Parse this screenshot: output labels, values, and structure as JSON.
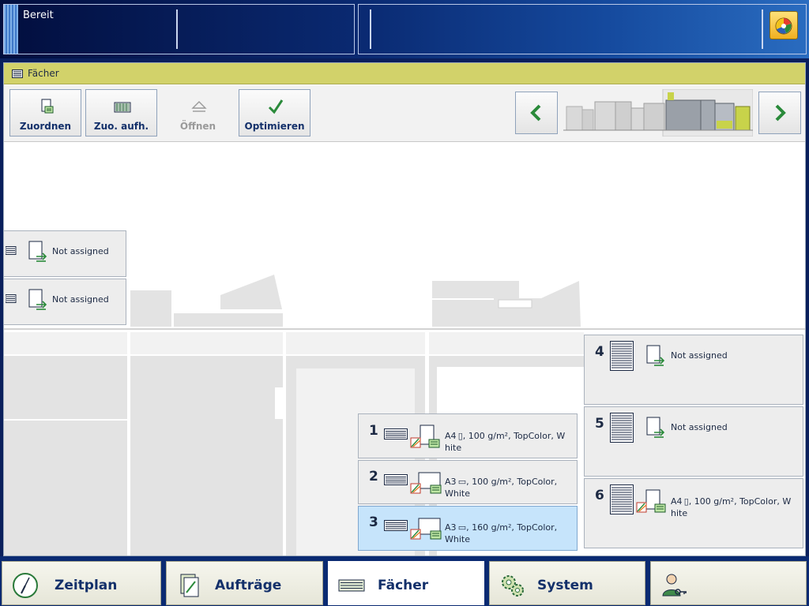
{
  "status": {
    "text": "Bereit"
  },
  "window": {
    "title": "Fächer"
  },
  "toolbar": {
    "assign_label": "Zuordnen",
    "unassign_label": "Zuo. aufh.",
    "open_label": "Öffnen",
    "optimize_label": "Optimieren"
  },
  "trays": [
    {
      "number": "",
      "line1": "Not assigned",
      "line2": ""
    },
    {
      "number": "",
      "line1": "Not assigned",
      "line2": ""
    },
    {
      "number": "1",
      "line1": "A4 ▯, 100 g/m², TopColor, W",
      "line2": "hite"
    },
    {
      "number": "2",
      "line1": "A3 ▭, 100 g/m², TopColor,",
      "line2": "White"
    },
    {
      "number": "3",
      "line1": "A3 ▭, 160 g/m², TopColor,",
      "line2": "White"
    },
    {
      "number": "4",
      "line1": "Not assigned",
      "line2": ""
    },
    {
      "number": "5",
      "line1": "Not assigned",
      "line2": ""
    },
    {
      "number": "6",
      "line1": "A4 ▯, 100 g/m², TopColor, W",
      "line2": "hite"
    }
  ],
  "tabs": {
    "schedule": "Zeitplan",
    "jobs": "Aufträge",
    "trays": "Fächer",
    "system": "System"
  },
  "colors": {
    "accent": "#d2d26a",
    "selected": "#c6e4fb",
    "topbar": "#0a2a72"
  },
  "icons": {
    "alert": "alert-icon",
    "tray": "tray-icon",
    "assign": "assign-icon",
    "unassign": "unassign-icon",
    "open": "eject-icon",
    "optimize": "checkmark-icon",
    "prev": "chevron-left-icon",
    "next": "chevron-right-icon",
    "schedule": "clock-icon",
    "jobs": "document-icon",
    "system": "gears-icon",
    "user": "user-key-icon"
  }
}
